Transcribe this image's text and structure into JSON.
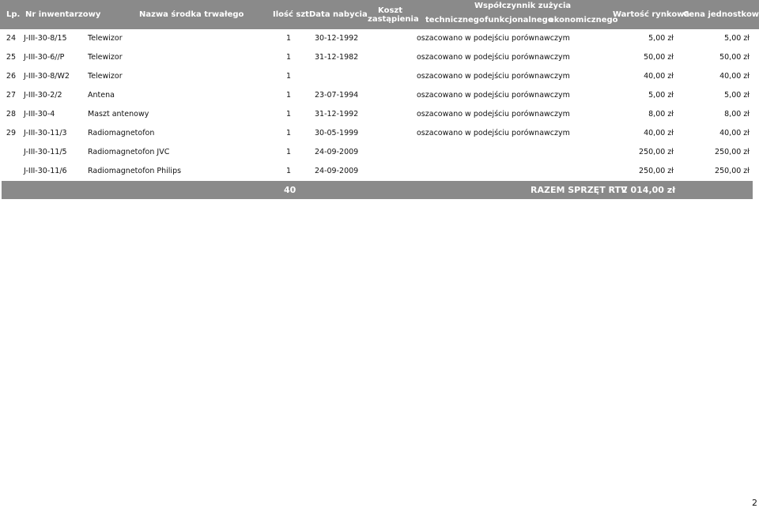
{
  "header": {
    "lp": "Lp.",
    "nr": "Nr inwentarzowy",
    "nazwa": "Nazwa środka trwałego",
    "ilosc": "Ilość szt.",
    "data": "Data nabycia",
    "koszt_1": "Koszt",
    "koszt_2": "zastąpienia",
    "wsp": "Współczynnik zużycia",
    "tech": "technicznego",
    "funk": "funkcjonalnego",
    "ekon": "ekonomicznego",
    "wartosc": "Wartość rynkowa",
    "cena": "Cena jednostkowa"
  },
  "rows": [
    {
      "lp": "24",
      "nr": "J-III-30-8/15",
      "nazwa": "Telewizor",
      "ilosc": "1",
      "data": "30-12-1992",
      "metoda": "oszacowano w podejściu porównawczym",
      "wartosc": "5,00 zł",
      "cena": "5,00 zł"
    },
    {
      "lp": "25",
      "nr": "J-III-30-6//P",
      "nazwa": "Telewizor",
      "ilosc": "1",
      "data": "31-12-1982",
      "metoda": "oszacowano w podejściu porównawczym",
      "wartosc": "50,00 zł",
      "cena": "50,00 zł"
    },
    {
      "lp": "26",
      "nr": "J-III-30-8/W2",
      "nazwa": "Telewizor",
      "ilosc": "1",
      "data": "",
      "metoda": "oszacowano w podejściu porównawczym",
      "wartosc": "40,00 zł",
      "cena": "40,00 zł"
    },
    {
      "lp": "27",
      "nr": "J-III-30-2/2",
      "nazwa": "Antena",
      "ilosc": "1",
      "data": "23-07-1994",
      "metoda": "oszacowano w podejściu porównawczym",
      "wartosc": "5,00 zł",
      "cena": "5,00 zł"
    },
    {
      "lp": "28",
      "nr": "J-III-30-4",
      "nazwa": "Maszt antenowy",
      "ilosc": "1",
      "data": "31-12-1992",
      "metoda": "oszacowano w podejściu porównawczym",
      "wartosc": "8,00 zł",
      "cena": "8,00 zł"
    },
    {
      "lp": "29",
      "nr": "J-III-30-11/3",
      "nazwa": "Radiomagnetofon",
      "ilosc": "1",
      "data": "30-05-1999",
      "metoda": "oszacowano w podejściu porównawczym",
      "wartosc": "40,00 zł",
      "cena": "40,00 zł"
    },
    {
      "lp": "",
      "nr": "J-III-30-11/5",
      "nazwa": "Radiomagnetofon JVC",
      "ilosc": "1",
      "data": "24-09-2009",
      "metoda": "",
      "wartosc": "250,00 zł",
      "cena": "250,00 zł"
    },
    {
      "lp": "",
      "nr": "J-III-30-11/6",
      "nazwa": "Radiomagnetofon Philips",
      "ilosc": "1",
      "data": "24-09-2009",
      "metoda": "",
      "wartosc": "250,00 zł",
      "cena": "250,00 zł"
    }
  ],
  "totals": {
    "ilosc": "40",
    "label": "RAZEM SPRZĘT RTV",
    "suma": "2 014,00 zł"
  },
  "page_number": "2"
}
